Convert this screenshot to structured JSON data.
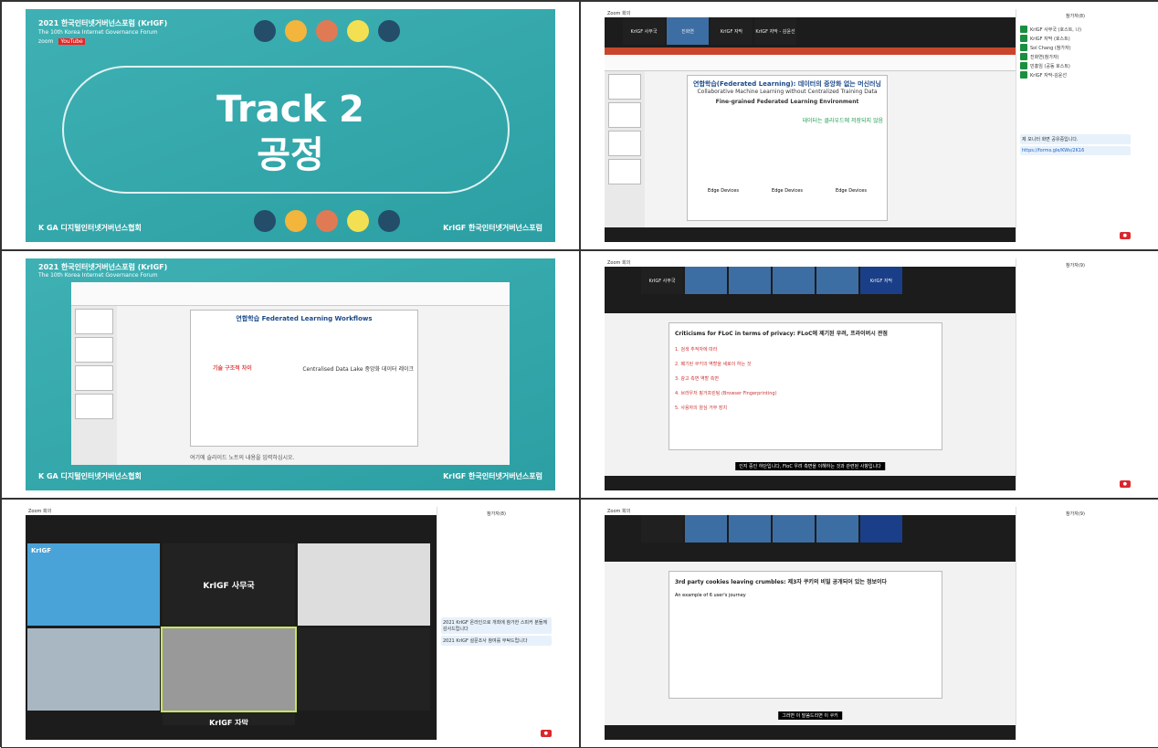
{
  "panel1": {
    "header_line1": "2021 한국인터넷거버넌스포럼 (KrIGF)",
    "header_line2": "The 10th Korea Internet Governance Forum",
    "zoom": "zoom",
    "youtube": "YouTube",
    "title_line1": "Track 2",
    "title_line2": "공정",
    "logo_left": "K GA 디지털인터넷거버넌스협회",
    "logo_right": "KrIGF 한국인터넷거버넌스포럼"
  },
  "panel2": {
    "window_title": "Zoom 회의",
    "tiles": [
      "KrIGF 사무국",
      "진화연",
      "KrIGF 자막",
      "KrIGF 자막 - 김윤선"
    ],
    "slide_title": "연합학습(Federated Learning): 데이터의 중앙화 없는 머신러닝",
    "slide_subtitle": "Collaborative Machine Learning without Centralized Training Data",
    "slide_box": "Fine-grained Federated Learning Environment",
    "slide_note": "데이터는 클라우드에 저장되지 않음",
    "labels": [
      "Edge Devices",
      "Edge Devices",
      "Edge Devices"
    ],
    "side_header": "참가자(8)",
    "participants": [
      "KrIGF 사무국 (호스트, 나)",
      "KrIGF 자막 (호스트)",
      "Sol Chang (참가자)",
      "진화연(참가자)",
      "민홍임 (공동 호스트)",
      "KrIGF 자막-김윤선"
    ],
    "chat": [
      "제 모니터 화면 공유중입니다.",
      "https://forms.gle/KWs/2K16"
    ]
  },
  "panel3": {
    "header_line1": "2021 한국인터넷거버넌스포럼 (KrIGF)",
    "header_line2": "The 10th Korea Internet Governance Forum",
    "slide_title": "연합학습 Federated Learning Workflows",
    "slide_note1": "기술 구조적 차이",
    "slide_note2": "Centralised Data Lake 중앙화 데이터 레이크",
    "caption": "여기에 슬라이드 노트의 내용을 입력하십시오.",
    "logo_left": "K GA 디지털인터넷거버넌스협회",
    "logo_right": "KrIGF 한국인터넷거버넌스포럼"
  },
  "panel4": {
    "window_title": "Zoom 회의",
    "tiles": [
      "KrIGF 사무국",
      "",
      "",
      "",
      "",
      "KrIGF 자막"
    ],
    "slide_title": "Criticisms for FLoC in terms of privacy: FLoC에 제기된 우려, 프라이버시 관점",
    "bullets": [
      "1. 검색 추적자에 따라",
      "2. 폐기된 쿠키의 역할을 새로이 하는 것",
      "3. 광고 측면 역할 측면",
      "4. 브라우저 핑거프린팅 (Browser Fingerprinting)",
      "5. 사용자의 양심 거부 장치"
    ],
    "caption": "인지 중인 하단입니다, FloC 우려 측면을 이해하는 것과 관련된 사항입니다",
    "side_header": "참가자(9)"
  },
  "panel5": {
    "window_title": "Zoom 회의",
    "banner": "KrIGF 사무국",
    "tile_logo": "KrIGF",
    "tile_mid": "KrIGF 사무국",
    "tile_bottom": "KrIGF 자막",
    "side_header": "참가자(8)",
    "chat": [
      "2021 KrIGF 온라인으로 개최에 참가한 스피커 분들께 감사드립니다",
      "2021 KrIGF 설문조사 참여를 부탁드립니다"
    ]
  },
  "panel6": {
    "window_title": "Zoom 회의",
    "slide_title": "3rd party cookies leaving crumbles: 제3자 쿠키의 비밀 공개되어 있는 정보이다",
    "slide_note": "An example of 6 user's journey",
    "caption": "그러면 이 말씀드리면 이 쿠키",
    "side_header": "참가자(9)"
  }
}
